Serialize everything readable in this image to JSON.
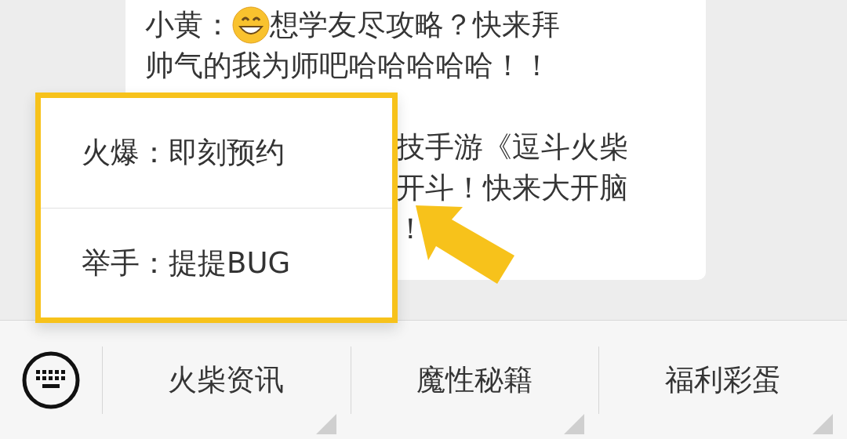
{
  "message": {
    "sender": "小黄：",
    "lines": [
      "想学友尽攻略？快来拜",
      "帅气的我为师吧哈哈哈哈哈！！"
    ],
    "partial_lines": [
      "技手游《逗斗火柴",
      "开斗！快来大开脑",
      "！"
    ]
  },
  "popup_menu": {
    "items": [
      {
        "label": "火爆：即刻预约"
      },
      {
        "label": "举手：提提BUG"
      }
    ]
  },
  "bottom_bar": {
    "menus": [
      {
        "label": "火柴资讯"
      },
      {
        "label": "魔性秘籍"
      },
      {
        "label": "福利彩蛋"
      }
    ]
  }
}
